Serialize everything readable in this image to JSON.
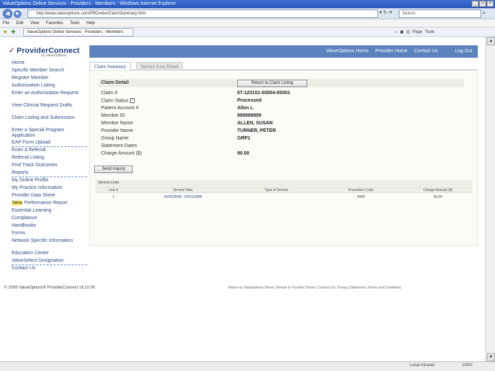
{
  "window": {
    "title": "ValueOptions Online Services - Providers - Members - Windows Internet Explorer"
  },
  "browser": {
    "url": "http://www.valueoptions.com/PROvider/ClaimSummary.html",
    "search_placeholder": "Search",
    "menu": [
      "File",
      "Edit",
      "View",
      "Favorites",
      "Tools",
      "Help"
    ],
    "tab_label": "ValueOptions Online Services - Providers - Members",
    "commands": [
      "Page",
      "Tools"
    ]
  },
  "site": {
    "logo": "ProviderConnect",
    "logo_sub": "by ValueOptions",
    "nav": [
      "ValueOptions Home",
      "Provider Home",
      "Contact Us",
      "Log Out"
    ]
  },
  "sidebar": [
    "Home",
    "Specific Member Search",
    "Register Member",
    "Authorization Listing",
    "Enter an Authorization Request",
    "View Clinical Request Drafts",
    "Claim Listing and Submission",
    "Enter a Special Program Application",
    "EAP Form Upload",
    "Enter a Referral",
    "Referral Listing",
    "Find Track Outcomes",
    "Reports",
    "My Online Profile",
    "My Practice Information",
    "Provider Data Sheet",
    "Performance Report",
    "Essential Learning",
    "Compliance",
    "Handbooks",
    "Forms",
    "Network Specific Information",
    "Education Center",
    "ValueSelect Designation",
    "Contact Us"
  ],
  "sidebar_highlight": "New",
  "tabs": [
    "Claim Summary",
    "Service Line Detail"
  ],
  "claim_detail": {
    "title": "Claim Detail",
    "button": "Return to Claim Listing",
    "fields": [
      {
        "label": "Claim #",
        "value": "07-123101-00004-00001"
      },
      {
        "label": "Claim Status",
        "value": "Processed"
      },
      {
        "label": "Patient Account #",
        "value": "Allen L"
      },
      {
        "label": "Member ID",
        "value": "999999999"
      },
      {
        "label": "Member Name",
        "value": "ALLEN, SUSAN"
      },
      {
        "label": "Provider Name",
        "value": "TURNER, PETER"
      },
      {
        "label": "Group Name",
        "value": "GRP1"
      },
      {
        "label": "Statement Dates",
        "value": ""
      },
      {
        "label": "Charge Amount ($)",
        "value": "90.00"
      }
    ],
    "send_inquiry": "Send Inquiry"
  },
  "service_lines": {
    "title": "Service Lines",
    "columns": [
      "Line #",
      "Service Date",
      "Type of Service",
      "Procedure Code",
      "Charge Amount ($)"
    ],
    "rows": [
      {
        "line": "1",
        "date": "01/01/2008 - 01/01/2008",
        "type": "",
        "code": "9999",
        "amount": "90.00"
      }
    ]
  },
  "footer": {
    "copyright": "© 2008 ValueOptions® ProviderConnect v3.10.00",
    "links": "Return to ValueOptions Home | Return to Provider Home | Contact Us | Privacy Statement | Terms and Conditions"
  },
  "status": {
    "zone": "Local intranet",
    "zoom": "100%"
  }
}
